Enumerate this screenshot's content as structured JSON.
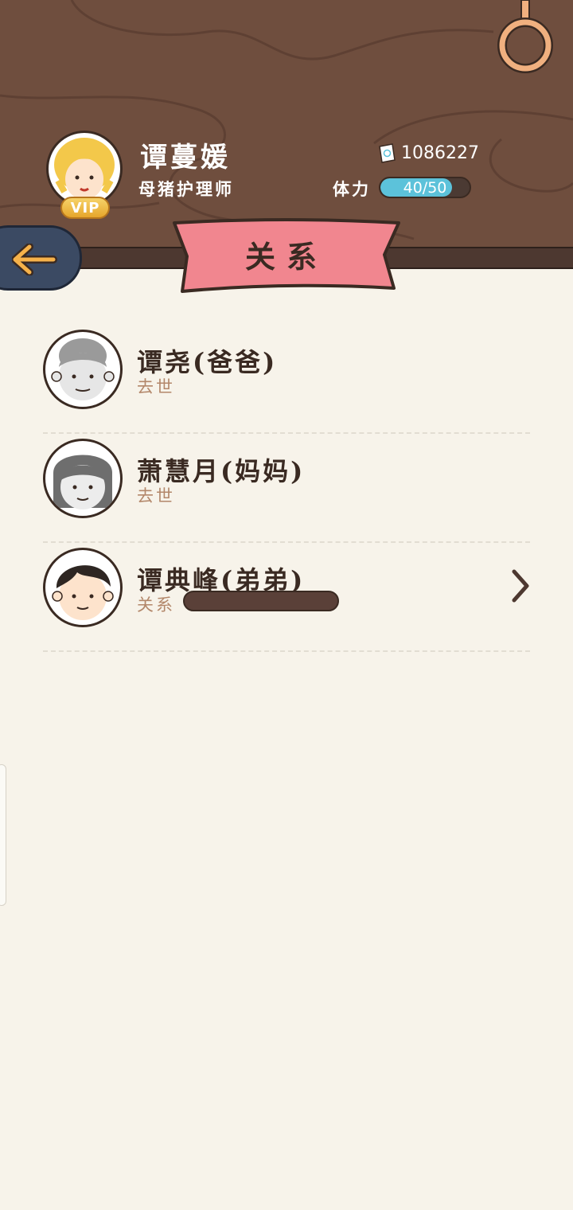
{
  "player": {
    "name": "谭蔓媛",
    "job": "母猪护理师",
    "vip_label": "VIP",
    "money": "1086227",
    "money_icon": "money-note-icon",
    "stamina_label": "体力",
    "stamina_text": "40/50",
    "stamina_fraction": 0.8
  },
  "nav": {
    "back_icon": "back-arrow-icon"
  },
  "page": {
    "title": "关系"
  },
  "relations": [
    {
      "name": "谭尧(爸爸)",
      "status": "去世"
    },
    {
      "name": "萧慧月(妈妈)",
      "status": "去世"
    },
    {
      "name": "谭典峰(弟弟)",
      "status": "关系",
      "relation_fraction": 0.0
    }
  ],
  "colors": {
    "header_bg": "#6f4e3e",
    "ribbon": "#f1868f",
    "stamina": "#5cc2da",
    "back_button": "#3b4a63",
    "page_bg": "#f7f3ea"
  }
}
